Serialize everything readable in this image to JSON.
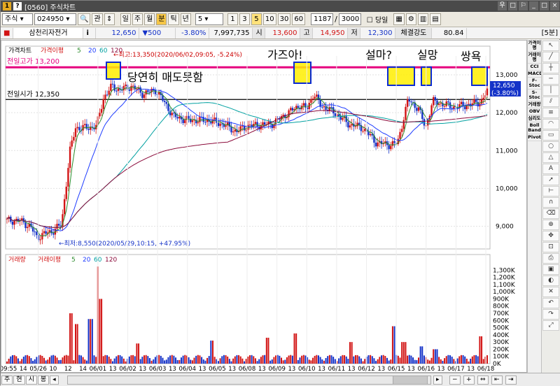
{
  "window": {
    "title": "[0560] 주식차트",
    "icon_num": "1",
    "help_icon": "?",
    "btn_a": "우",
    "btn_b": "□"
  },
  "toolbar": {
    "market": "주식",
    "code": "024950",
    "gwan": "관",
    "periods": [
      "일",
      "주",
      "월",
      "분",
      "틱",
      "년"
    ],
    "active_period": "분",
    "interval": "5",
    "minutes": [
      "1",
      "3",
      "5",
      "10",
      "30",
      "60"
    ],
    "active_minute": "5",
    "count1": "1187",
    "slash": "/",
    "count2": "3000",
    "dangil": "당일"
  },
  "quote": {
    "name": "삼천리자전거",
    "info": "i",
    "price": "12,650",
    "change": "▼500",
    "pct": "-3.80%",
    "volume": "7,997,735",
    "open_label": "시",
    "open": "13,600",
    "high_label": "고",
    "high": "14,950",
    "low_label": "저",
    "low": "12,300",
    "strength_label": "체결강도",
    "strength": "80.84",
    "min_badge": "[5분]"
  },
  "price_panel": {
    "legend": [
      "가격차트",
      "가격이평",
      "5",
      "20",
      "60",
      "120"
    ],
    "ref_high_label": "전일고가 13,200",
    "ref_open_label": "전일시가 12,350",
    "max_note": "←최고:13,350(2020/06/02,09:05, -5.24%)",
    "min_note": "←최저:8,550(2020/05/29,10:15, +47.95%)",
    "cur_price": "12,650",
    "cur_pct": "(-3.80%)",
    "annotations": [
      "당연히 매도못함",
      "가즈아!",
      "설마?",
      "실망",
      "쌍욕"
    ],
    "y_ticks": [
      "13,000",
      "12,000",
      "11,000",
      "10,000",
      "9,000"
    ]
  },
  "volume_panel": {
    "legend": [
      "거래량",
      "거래이평",
      "5",
      "20",
      "60",
      "120"
    ],
    "y_ticks": [
      "1,300K",
      "1,200K",
      "1,100K",
      "1,000K",
      "900K",
      "800K",
      "700K",
      "600K",
      "500K",
      "400K",
      "300K",
      "200K",
      "100K",
      "0K"
    ]
  },
  "x_axis": [
    "09:55",
    "14",
    "05/26",
    "10",
    "12",
    "14",
    "06/01",
    "13",
    "06/02",
    "13",
    "06/03",
    "13",
    "06/04",
    "13",
    "06/05",
    "13",
    "06/08",
    "13",
    "06/09",
    "13",
    "06/10",
    "13",
    "06/11",
    "13",
    "06/12",
    "13",
    "06/15",
    "13",
    "06/16",
    "13",
    "06/17",
    "13",
    "06/18"
  ],
  "sidebar": [
    "가격이평",
    "거래이평",
    "CCI",
    "MACD",
    "F-Stoc",
    "S-Stoc",
    "거래량",
    "OBV",
    "심리도",
    "Boll Band",
    "Pivot"
  ],
  "bottom": [
    "주",
    "현",
    "시",
    "봉"
  ],
  "colors": {
    "high_line": "#e6007e",
    "price_up": "#d21414",
    "price_down": "#1432c8",
    "ma5": "#2a8a2a",
    "ma20": "#1e3cff",
    "ma60": "#00a0a0",
    "ma120": "#8a0a3a",
    "highlight": "#ffee00",
    "highlight_border": "#0a2ad2"
  }
}
